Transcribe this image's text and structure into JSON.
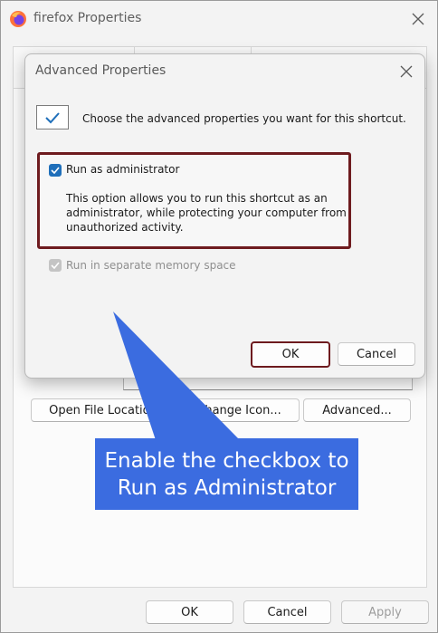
{
  "outer_window": {
    "title": "firefox Properties",
    "buttons": {
      "open_file_location": "Open File Location",
      "change_icon": "Change Icon...",
      "advanced": "Advanced...",
      "ok": "OK",
      "cancel": "Cancel",
      "apply": "Apply"
    }
  },
  "advanced_dialog": {
    "title": "Advanced Properties",
    "instruction": "Choose the advanced properties you want for this shortcut.",
    "run_as_admin": {
      "label": "Run as administrator",
      "checked": true,
      "description": "This option allows you to run this shortcut as an administrator, while protecting your computer from unauthorized activity."
    },
    "separate_memory": {
      "label": "Run in separate memory space",
      "checked": true,
      "disabled": true
    },
    "ok_label": "OK",
    "cancel_label": "Cancel"
  },
  "annotation": {
    "line1": "Enable the checkbox to",
    "line2": "Run as Administrator"
  },
  "colors": {
    "highlight_border": "#6e1b1f",
    "callout_bg": "#3b6ce0",
    "checkbox_accent": "#1f6fba"
  }
}
